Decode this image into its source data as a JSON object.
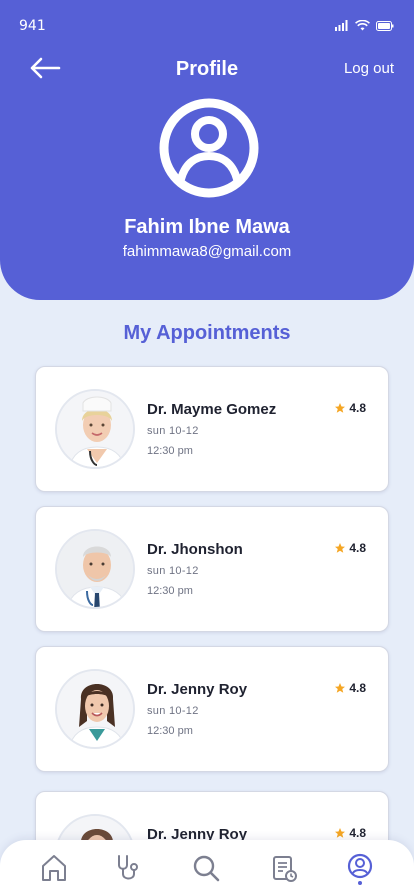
{
  "status_bar": {
    "time": "941"
  },
  "header": {
    "title": "Profile",
    "logout_label": "Log out",
    "user_name": "Fahim Ibne Mawa",
    "user_email": "fahimmawa8@gmail.com"
  },
  "appointments": {
    "section_title": "My Appointments",
    "items": [
      {
        "doctor": "Dr. Mayme Gomez",
        "day": "sun  10-12",
        "time": "12:30 pm",
        "rating": "4.8"
      },
      {
        "doctor": "Dr. Jhonshon",
        "day": "sun  10-12",
        "time": "12:30 pm",
        "rating": "4.8"
      },
      {
        "doctor": "Dr. Jenny Roy",
        "day": "sun  10-12",
        "time": "12:30 pm",
        "rating": "4.8"
      },
      {
        "doctor": "Dr. Jenny Roy",
        "day": "",
        "time": "",
        "rating": "4.8"
      }
    ]
  },
  "bottom_nav": {
    "items": [
      "home-icon",
      "stethoscope-icon",
      "search-icon",
      "records-icon",
      "profile-icon"
    ],
    "active": "profile-icon"
  },
  "colors": {
    "primary": "#5660d6",
    "background": "#e6edf9",
    "star": "#f5a623",
    "nav_icon": "#7c7f90"
  }
}
